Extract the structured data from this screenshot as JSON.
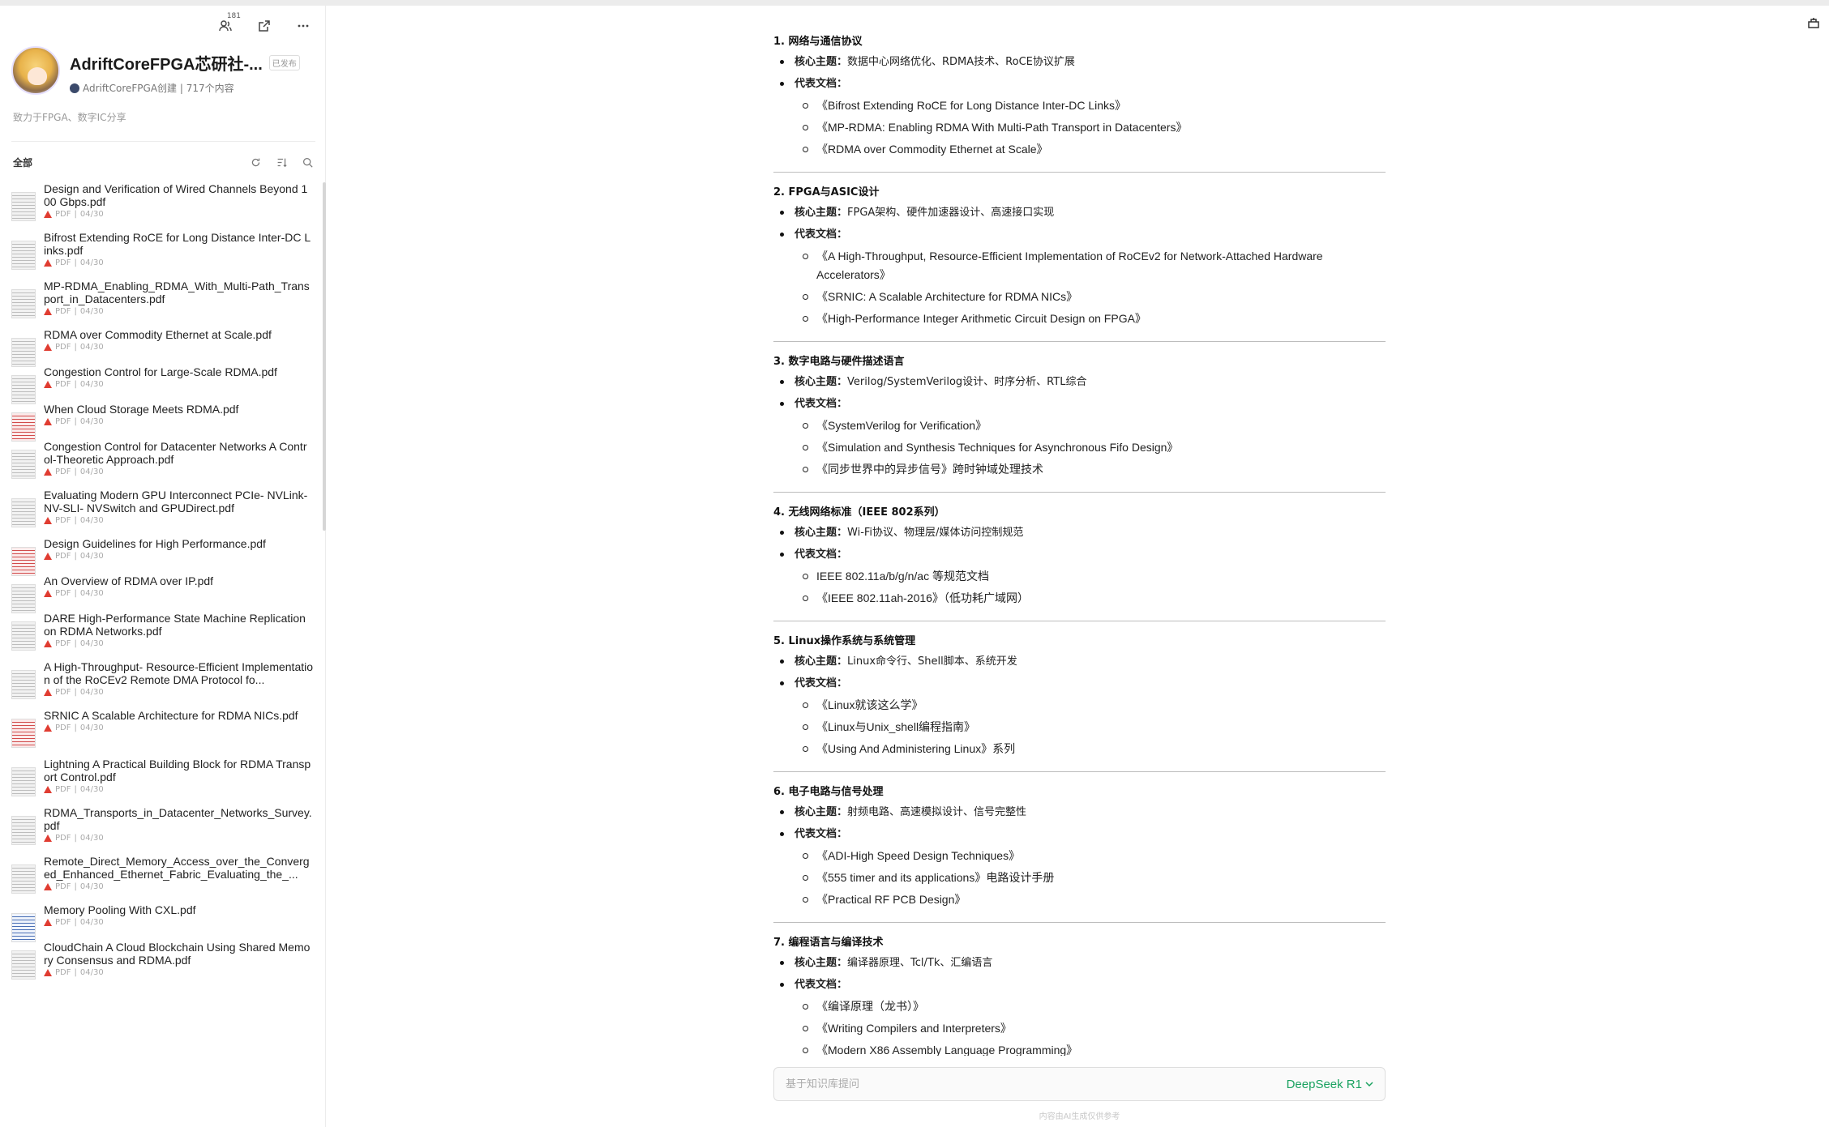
{
  "sidebar": {
    "tools": {
      "members_count": "181"
    },
    "kb": {
      "title": "AdriftCoreFPGA芯研社-...",
      "tag": "已发布",
      "meta": "AdriftCoreFPGA创建 | 717个内容",
      "desc": "致力于FPGA、数字IC分享"
    },
    "filter_label": "全部",
    "docs": [
      {
        "name": "Design and Verification of Wired Channels Beyond 100 Gbps.pdf",
        "type": "PDF",
        "date": "04/30",
        "thumb": "gray"
      },
      {
        "name": "Bifrost Extending RoCE for Long Distance Inter-DC Links.pdf",
        "type": "PDF",
        "date": "04/30",
        "thumb": "gray"
      },
      {
        "name": "MP-RDMA_Enabling_RDMA_With_Multi-Path_Transport_in_Datacenters.pdf",
        "type": "PDF",
        "date": "04/30",
        "thumb": "gray"
      },
      {
        "name": "RDMA over Commodity Ethernet at Scale.pdf",
        "type": "PDF",
        "date": "04/30",
        "thumb": "gray"
      },
      {
        "name": "Congestion Control for Large-Scale RDMA.pdf",
        "type": "PDF",
        "date": "04/30",
        "thumb": "gray"
      },
      {
        "name": "When Cloud Storage Meets RDMA.pdf",
        "type": "PDF",
        "date": "04/30",
        "thumb": "red"
      },
      {
        "name": "Congestion Control for Datacenter Networks A Control-Theoretic Approach.pdf",
        "type": "PDF",
        "date": "04/30",
        "thumb": "gray"
      },
      {
        "name": "Evaluating Modern GPU Interconnect PCIe- NVLink- NV-SLI- NVSwitch and GPUDirect.pdf",
        "type": "PDF",
        "date": "04/30",
        "thumb": "gray"
      },
      {
        "name": "Design Guidelines for High Performance.pdf",
        "type": "PDF",
        "date": "04/30",
        "thumb": "red"
      },
      {
        "name": "An Overview of RDMA over IP.pdf",
        "type": "PDF",
        "date": "04/30",
        "thumb": "gray"
      },
      {
        "name": "DARE High-Performance State Machine Replication on RDMA Networks.pdf",
        "type": "PDF",
        "date": "04/30",
        "thumb": "gray"
      },
      {
        "name": "A High-Throughput- Resource-Efficient Implementation of the RoCEv2 Remote DMA Protocol fo...",
        "type": "PDF",
        "date": "04/30",
        "thumb": "gray"
      },
      {
        "name": "SRNIC A Scalable Architecture for RDMA NICs.pdf",
        "type": "PDF",
        "date": "04/30",
        "thumb": "red"
      },
      {
        "name": "Lightning A Practical Building Block for RDMA Transport Control.pdf",
        "type": "PDF",
        "date": "04/30",
        "thumb": "gray"
      },
      {
        "name": "RDMA_Transports_in_Datacenter_Networks_Survey.pdf",
        "type": "PDF",
        "date": "04/30",
        "thumb": "gray"
      },
      {
        "name": "Remote_Direct_Memory_Access_over_the_Converged_Enhanced_Ethernet_Fabric_Evaluating_the_...",
        "type": "PDF",
        "date": "04/30",
        "thumb": "gray"
      },
      {
        "name": "Memory Pooling With CXL.pdf",
        "type": "PDF",
        "date": "04/30",
        "thumb": "blue"
      },
      {
        "name": "CloudChain A Cloud Blockchain Using Shared Memory Consensus and RDMA.pdf",
        "type": "PDF",
        "date": "04/30",
        "thumb": "gray"
      }
    ]
  },
  "main": {
    "label_topic": "核心主题：",
    "label_docs": "代表文档：",
    "sections": [
      {
        "title": "1. 网络与通信协议",
        "topic": "数据中心网络优化、RDMA技术、RoCE协议扩展",
        "docs": [
          "《Bifrost Extending RoCE for Long Distance Inter-DC Links》",
          "《MP-RDMA: Enabling RDMA With Multi-Path Transport in Datacenters》",
          "《RDMA over Commodity Ethernet at Scale》"
        ]
      },
      {
        "title": "2. FPGA与ASIC设计",
        "topic": "FPGA架构、硬件加速器设计、高速接口实现",
        "docs": [
          "《A High-Throughput, Resource-Efficient Implementation of RoCEv2 for Network-Attached Hardware Accelerators》",
          "《SRNIC: A Scalable Architecture for RDMA NICs》",
          "《High-Performance Integer Arithmetic Circuit Design on FPGA》"
        ]
      },
      {
        "title": "3. 数字电路与硬件描述语言",
        "topic": "Verilog/SystemVerilog设计、时序分析、RTL综合",
        "docs": [
          "《SystemVerilog for Verification》",
          "《Simulation and Synthesis Techniques for Asynchronous Fifo Design》",
          "《同步世界中的异步信号》跨时钟域处理技术"
        ]
      },
      {
        "title": "4. 无线网络标准（IEEE 802系列）",
        "topic": "Wi-Fi协议、物理层/媒体访问控制规范",
        "docs": [
          "IEEE 802.11a/b/g/n/ac 等规范文档",
          "《IEEE 802.11ah-2016》（低功耗广域网）"
        ]
      },
      {
        "title": "5. Linux操作系统与系统管理",
        "topic": "Linux命令行、Shell脚本、系统开发",
        "docs": [
          "《Linux就该这么学》",
          "《Linux与Unix_shell编程指南》",
          "《Using And Administering Linux》系列"
        ]
      },
      {
        "title": "6. 电子电路与信号处理",
        "topic": "射频电路、高速模拟设计、信号完整性",
        "docs": [
          "《ADI-High Speed Design Techniques》",
          "《555 timer and its applications》电路设计手册",
          "《Practical RF PCB Design》"
        ]
      },
      {
        "title": "7. 编程语言与编译技术",
        "topic": "编译器原理、Tcl/Tk、汇编语言",
        "docs": [
          "《编译原理（龙书）》",
          "《Writing Compilers and Interpreters》",
          "《Modern X86 Assembly Language Programming》"
        ]
      }
    ],
    "input": {
      "placeholder": "基于知识库提问",
      "value": ""
    },
    "model": "DeepSeek R1",
    "footer": "内容由AI生成仅供参考"
  }
}
